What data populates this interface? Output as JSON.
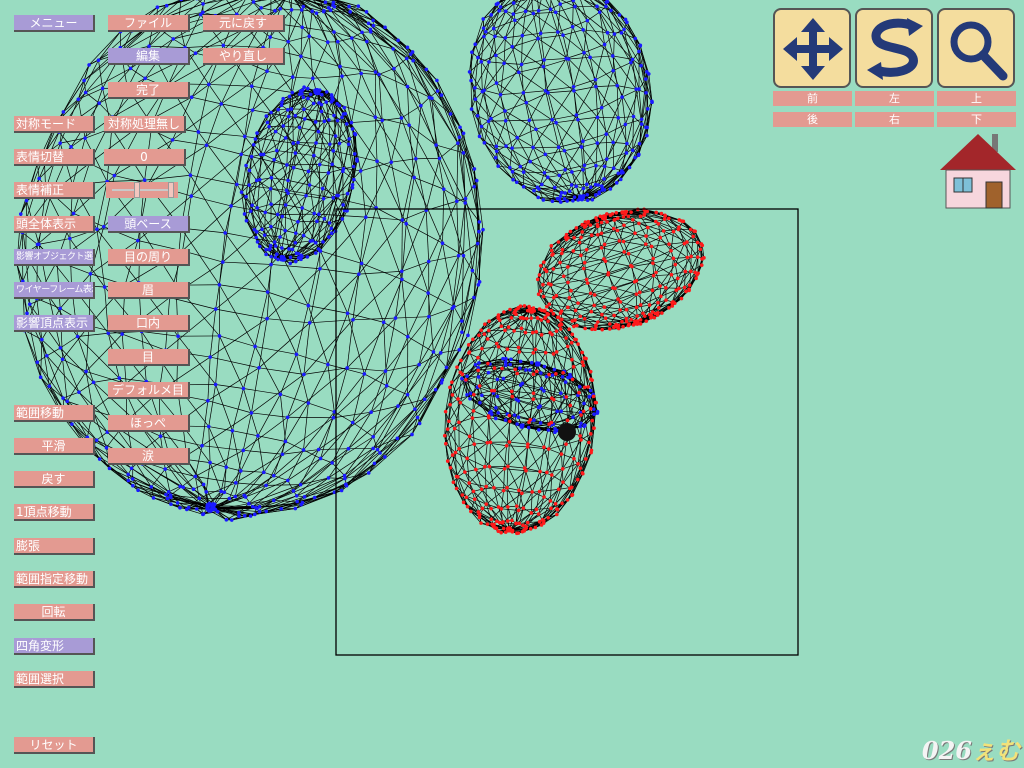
{
  "menu": "メニュー",
  "file": "ファイル",
  "undo": "元に戻す",
  "edit": "編集",
  "redo": "やり直し",
  "done": "完了",
  "sym_mode": "対称モード",
  "sym_none": "対称処理無し",
  "expr_switch": "表情切替",
  "expr_value": "0",
  "expr_fix": "表情補正",
  "slider": {
    "value": 0.5
  },
  "head_all": "頭全体表示",
  "head_base": "頭ベース",
  "affect_obj": "影響オブジェクト選択",
  "eye_around": "目の周り",
  "wireframe": "ワイヤーフレーム表示",
  "eyebrow": "眉",
  "affect_vert": "影響頂点表示",
  "mouth": "口内",
  "eye": "目",
  "deform_eye": "デフォルメ目",
  "cheek": "ほっぺ",
  "tear": "涙",
  "tools": {
    "range_move": "範囲移動",
    "smooth": "平滑",
    "restore": "戻す",
    "one_vertex": "1頂点移動",
    "inflate": "膨張",
    "range_spec_move": "範囲指定移動",
    "rotate": "回転",
    "quad_deform": "四角変形",
    "range_select": "範囲選択",
    "reset": "リセット"
  },
  "view": {
    "front": "前",
    "left": "左",
    "top": "上",
    "back": "後",
    "right": "右",
    "bottom": "下",
    "icons": [
      "move-arrows-icon",
      "rotate-icon",
      "magnifier-icon"
    ]
  },
  "logo": {
    "digits": "026",
    "kana": "ぇむ"
  },
  "colors": {
    "background": "#99dcc1",
    "button": "#e39a91",
    "selected": "#a89bd6",
    "tool": "#f4dd9e",
    "wire_blue": "#1a1aff",
    "wire_red": "#ff1a1a"
  }
}
